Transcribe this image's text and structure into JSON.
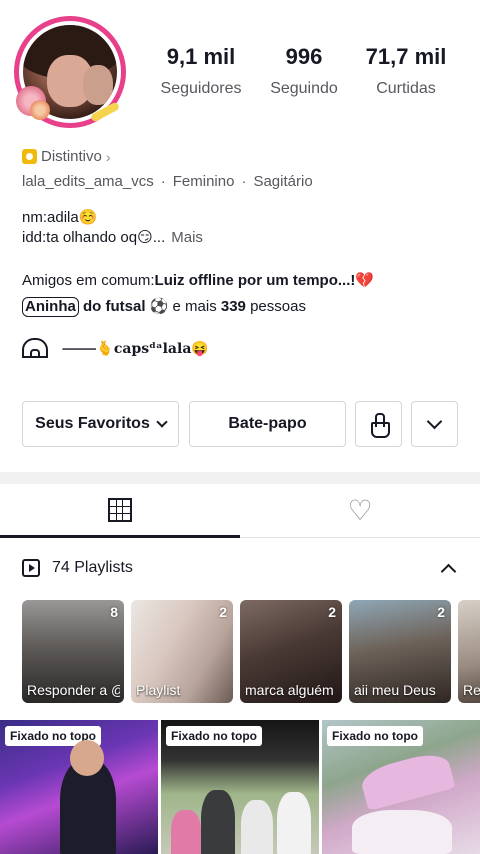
{
  "profile": {
    "stats": [
      {
        "value": "9,1 mil",
        "label": "Seguidores"
      },
      {
        "value": "996",
        "label": "Seguindo"
      },
      {
        "value": "71,7 mil",
        "label": "Curtidas"
      }
    ],
    "badge_label": "Distintivo",
    "username": "lala_edits_ama_vcs",
    "gender": "Feminino",
    "sign": "Sagitário",
    "bio_line1": "nm:adila☺️",
    "bio_line2": "idd:ta olhando oq😏...",
    "bio_more": "Mais",
    "friends_prefix": "Amigos em comum:",
    "friends_first": "Luiz offline por um tempo...!💔",
    "friends_second_bubble": "Aninha",
    "friends_second_rest": " do futsal ⚽",
    "friends_mid": " e mais ",
    "friends_count": "339",
    "friends_suffix": " pessoas",
    "link_text": "⸻🫰capsᵈᵃlala😝"
  },
  "actions": {
    "favorites_label": "Seus Favoritos",
    "chat_label": "Bate-papo"
  },
  "tabs": {
    "videos_icon": "grid-icon",
    "liked_icon": "heart-icon"
  },
  "playlists": {
    "header": "74 Playlists",
    "items": [
      {
        "count": "8",
        "title": "Responder a @ @ Beh edits.!..."
      },
      {
        "count": "2",
        "title": "Playlist"
      },
      {
        "count": "2",
        "title": "marca alguém aí🥺❤️@—"
      },
      {
        "count": "2",
        "title": "aii meu Deus"
      },
      {
        "count": "",
        "title": "Res"
      }
    ]
  },
  "videos": {
    "pinned_label": "Fixado no topo",
    "items": [
      {
        "pinned": true
      },
      {
        "pinned": true
      },
      {
        "pinned": true
      }
    ]
  }
}
